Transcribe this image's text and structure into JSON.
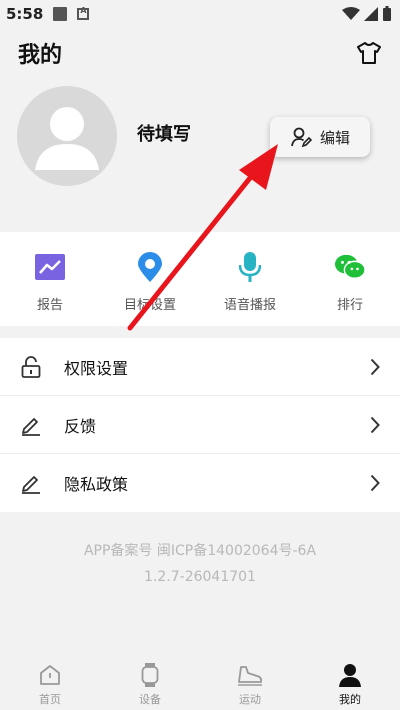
{
  "status_bar": {
    "time": "5:58"
  },
  "header": {
    "title": "我的"
  },
  "profile": {
    "name": "待填写",
    "edit_label": "编辑"
  },
  "quick_actions": [
    {
      "label": "报告",
      "icon": "chart-icon"
    },
    {
      "label": "目标设置",
      "icon": "location-pin-icon"
    },
    {
      "label": "语音播报",
      "icon": "microphone-icon"
    },
    {
      "label": "排行",
      "icon": "wechat-icon"
    }
  ],
  "menu": [
    {
      "label": "权限设置",
      "icon": "unlock-icon"
    },
    {
      "label": "反馈",
      "icon": "pencil-icon"
    },
    {
      "label": "隐私政策",
      "icon": "pencil-icon"
    }
  ],
  "footer": {
    "line1": "APP备案号 闽ICP备14002064号-6A",
    "line2": "1.2.7-26041701"
  },
  "tabs": [
    {
      "label": "首页",
      "icon": "home-icon"
    },
    {
      "label": "设备",
      "icon": "watch-icon"
    },
    {
      "label": "运动",
      "icon": "shoe-icon"
    },
    {
      "label": "我的",
      "icon": "person-icon",
      "active": true
    }
  ],
  "colors": {
    "report": "#7a63e0",
    "target": "#2a8de8",
    "voice": "#27b3c4",
    "rank": "#1fbf3a",
    "annotation_arrow": "#e8161c"
  }
}
